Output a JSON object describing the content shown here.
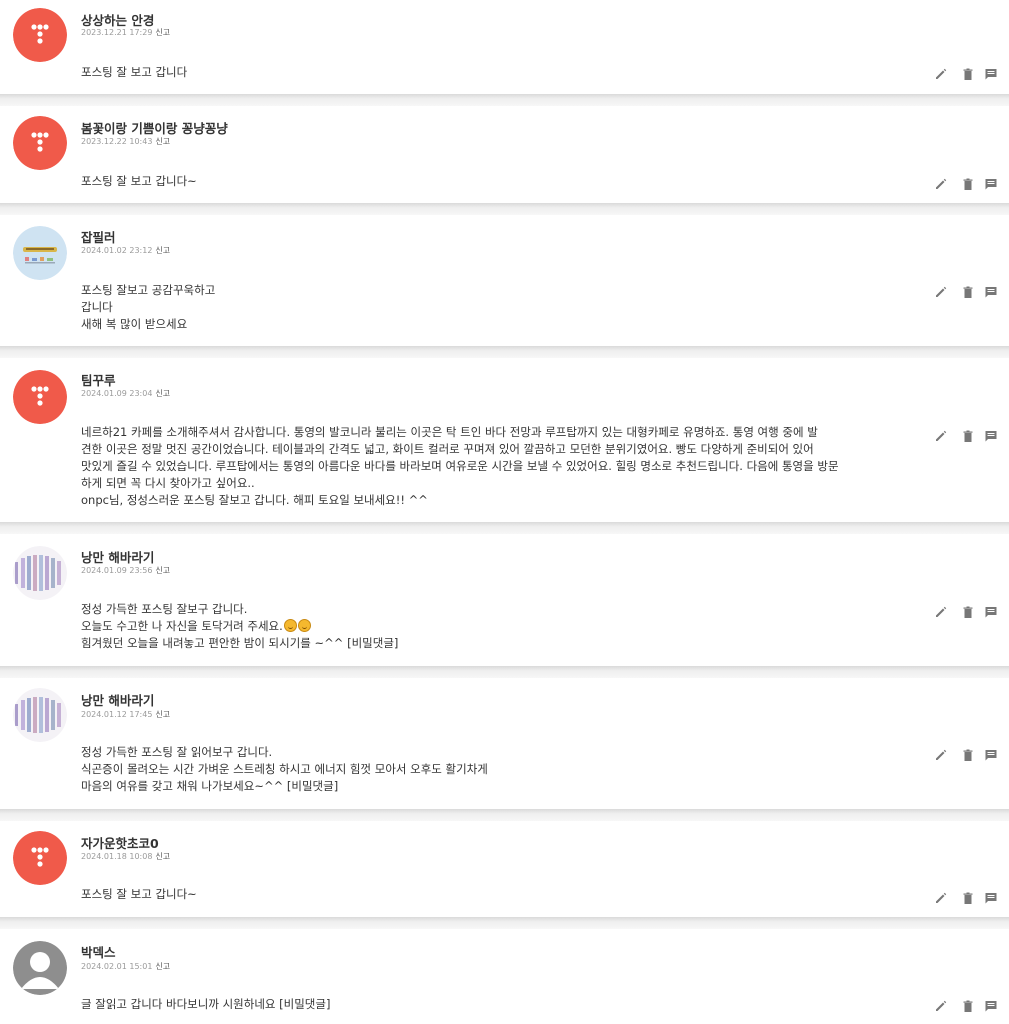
{
  "colors": {
    "avatar_default": "#f05a4a",
    "icon_gray": "#777777",
    "meta_gray": "#9a9a9a"
  },
  "report_label": "신고",
  "comments": [
    {
      "name": "상상하는 안경",
      "date": "2023.12.21 17:29",
      "avatar": "red-dots",
      "lines": [
        "포스팅 잘 보고 갑니다"
      ]
    },
    {
      "name": "봄꽃이랑 기쁨이랑 꽁냥꽁냥",
      "date": "2023.12.22 10:43",
      "avatar": "red-dots",
      "lines": [
        "포스팅 잘 보고 갑니다~"
      ]
    },
    {
      "name": "잡필러",
      "date": "2024.01.02 23:12",
      "avatar": "photo-blue",
      "lines": [
        "포스팅 잘보고 공감꾸욱하고",
        "갑니다",
        "새해 복 많이 받으세요"
      ]
    },
    {
      "name": "팀꾸루",
      "date": "2024.01.09 23:04",
      "avatar": "red-dots",
      "lines": [
        "네르하21 카페를 소개해주셔서 감사합니다. 통영의 발코니라 불리는 이곳은 탁 트인 바다 전망과 루프탑까지 있는 대형카페로 유명하죠. 통영 여행 중에 발",
        "견한 이곳은 정말 멋진 공간이었습니다. 테이블과의 간격도 넓고, 화이트 컬러로 꾸며져 있어 깔끔하고 모던한 분위기였어요. 빵도 다양하게 준비되어 있어",
        "맛있게 즐길 수 있었습니다. 루프탑에서는 통영의 아름다운 바다를 바라보며 여유로운 시간을 보낼 수 있었어요. 힐링 명소로 추천드립니다. 다음에 통영을 방문",
        "하게 되면 꼭 다시 찾아가고 싶어요..",
        "onpc님, 정성스러운 포스팅 잘보고 갑니다. 해피 토요일 보내세요!! ^^"
      ]
    },
    {
      "name": "낭만 해바라기",
      "date": "2024.01.09 23:56",
      "avatar": "carpe-diem",
      "lines": [
        "정성 가득한 포스팅 잘보구 갑니다.",
        "오늘도 수고한 나 자신을 토닥거려 주세요.",
        "힘겨웠던 오늘을 내려놓고 편안한 밤이 되시기를 ~^^ [비밀댓글]"
      ]
    },
    {
      "name": "낭만 해바라기",
      "date": "2024.01.12 17:45",
      "avatar": "carpe-diem",
      "lines": [
        "정성 가득한 포스팅 잘 읽어보구 갑니다.",
        "식곤증이 몰려오는 시간 가벼운 스트레칭 하시고 에너지 힘껏 모아서 오후도 활기차게",
        "마음의 여유를 갖고 채워 나가보세요~^^ [비밀댓글]"
      ]
    },
    {
      "name": "자가운핫초코0",
      "date": "2024.01.18 10:08",
      "avatar": "red-dots",
      "lines": [
        "포스팅 잘 보고 갑니다~"
      ]
    },
    {
      "name": "박덱스",
      "date": "2024.02.01 15:01",
      "avatar": "default-gray",
      "lines": [
        "글 잘읽고 갑니다 바다보니까 시원하네요 [비밀댓글]"
      ]
    }
  ]
}
